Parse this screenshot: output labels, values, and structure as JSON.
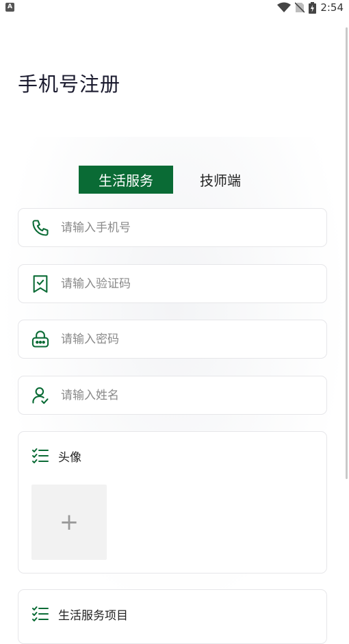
{
  "status_bar": {
    "time": "2:54",
    "app_icon_letter": "A",
    "icons": [
      "wifi-icon",
      "no-sim-icon",
      "battery-charging-icon"
    ]
  },
  "page": {
    "title": "手机号注册"
  },
  "tabs": [
    {
      "label": "生活服务",
      "active": true
    },
    {
      "label": "技师端",
      "active": false
    }
  ],
  "form": {
    "phone": {
      "placeholder": "请输入手机号",
      "value": "",
      "icon": "phone-icon"
    },
    "code": {
      "placeholder": "请输入验证码",
      "value": "",
      "icon": "shield-check-icon"
    },
    "password": {
      "placeholder": "请输入密码",
      "value": "",
      "icon": "lock-icon"
    },
    "name": {
      "placeholder": "请输入姓名",
      "value": "",
      "icon": "user-check-icon"
    }
  },
  "avatar_card": {
    "label": "头像",
    "icon": "checklist-icon",
    "upload_symbol": "+"
  },
  "service_card": {
    "label": "生活服务项目",
    "icon": "checklist-icon"
  },
  "colors": {
    "accent": "#0a6b35",
    "border": "#e6e6e9",
    "placeholder": "#8a8a8a"
  }
}
